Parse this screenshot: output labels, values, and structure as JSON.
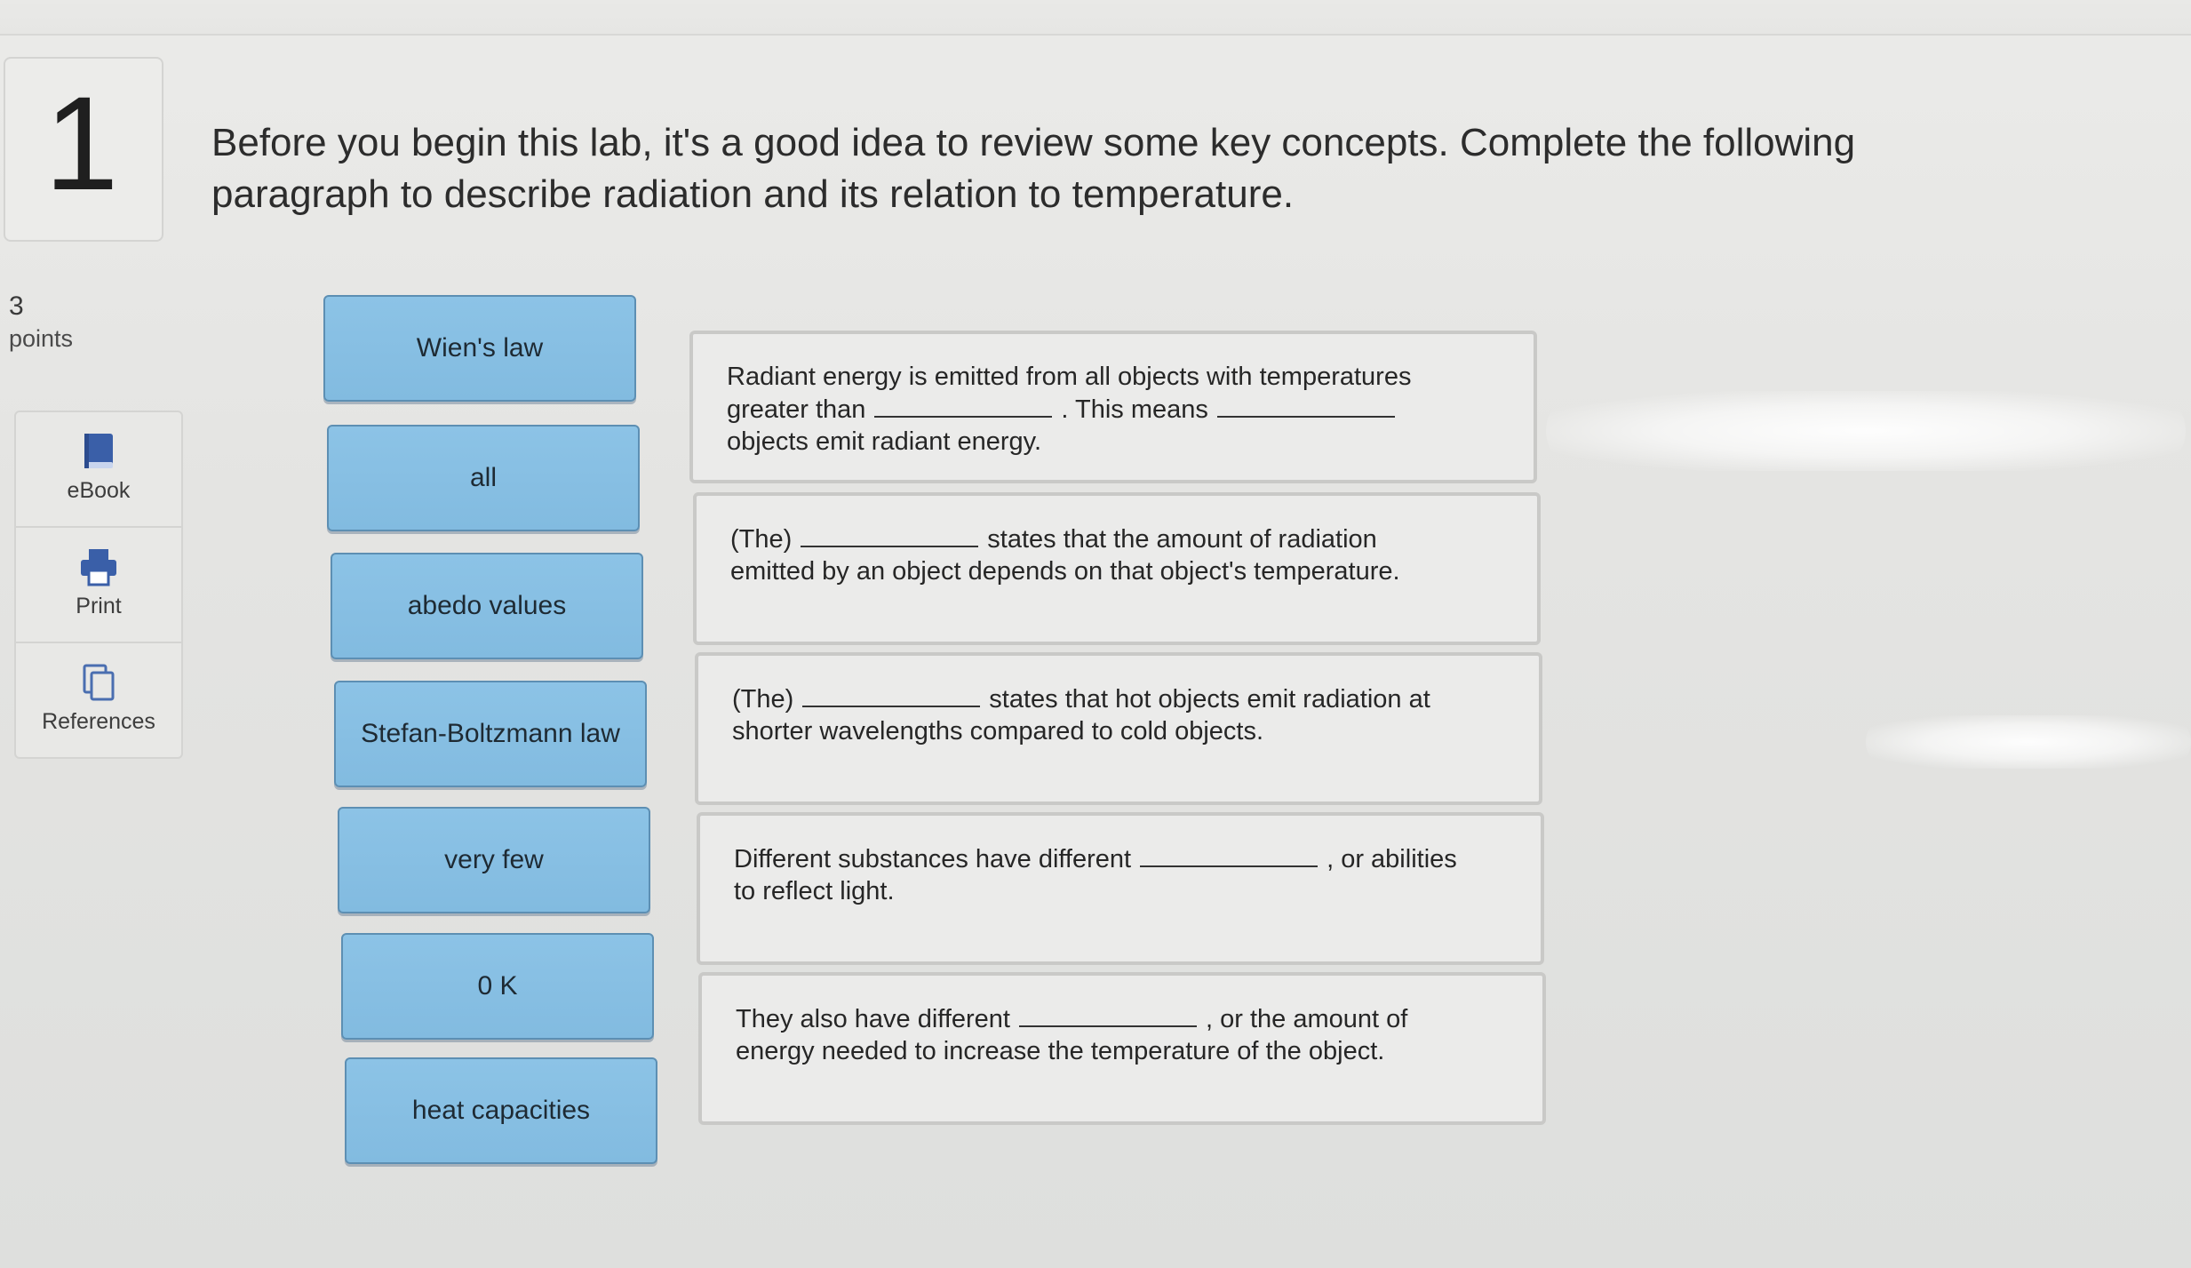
{
  "question": {
    "number": "1",
    "text": "Before you begin this lab, it's a good idea to review some key concepts. Complete the following paragraph to describe radiation and its relation to temperature.",
    "points_value": "3",
    "points_label": "points"
  },
  "tools": [
    {
      "label": "eBook",
      "icon": "book-icon"
    },
    {
      "label": "Print",
      "icon": "printer-icon"
    },
    {
      "label": "References",
      "icon": "copy-icon"
    }
  ],
  "tiles": [
    {
      "label": "Wien's law"
    },
    {
      "label": "all"
    },
    {
      "label": "abedo values"
    },
    {
      "label": "Stefan-Boltzmann law"
    },
    {
      "label": "very few"
    },
    {
      "label": "0 K"
    },
    {
      "label": "heat capacities"
    }
  ],
  "sentences": [
    {
      "line1_a": "Radiant energy is emitted from all objects with temperatures",
      "line2_a": "greater than",
      "line2_b": ". This means",
      "line3": "objects emit radiant energy."
    },
    {
      "line1_a": "(The)",
      "line1_b": "states that the amount of radiation",
      "line2": "emitted by an object depends on that object's temperature."
    },
    {
      "line1_a": "(The)",
      "line1_b": "states that hot objects emit radiation at",
      "line2": "shorter wavelengths compared to cold objects."
    },
    {
      "line1_a": "Different substances have different",
      "line1_b": ", or abilities",
      "line2": "to reflect light."
    },
    {
      "line1_a": "They also have different",
      "line1_b": ", or the amount of",
      "line2": "energy needed to increase the temperature of the object."
    }
  ],
  "colors": {
    "tile": "#86bfe3",
    "tile_border": "#5d8fb3",
    "background": "#e6e6e4"
  }
}
